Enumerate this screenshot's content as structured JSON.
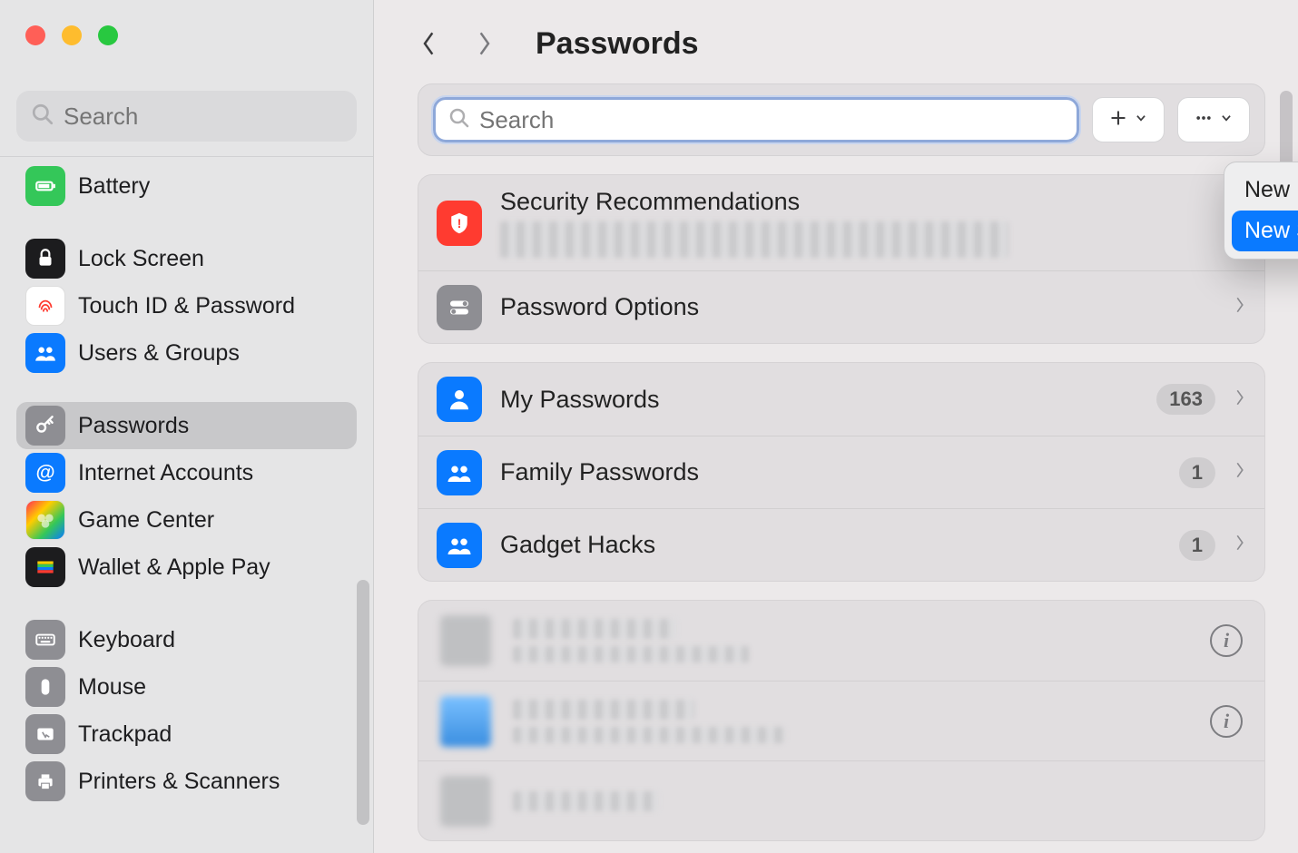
{
  "sidebar": {
    "search_placeholder": "Search",
    "items": [
      {
        "label": "Battery",
        "icon": "battery-icon",
        "bg": "bg-green"
      },
      {
        "label": "Lock Screen",
        "icon": "lock-icon",
        "bg": "bg-black"
      },
      {
        "label": "Touch ID & Password",
        "icon": "fingerprint-icon",
        "bg": "bg-white"
      },
      {
        "label": "Users & Groups",
        "icon": "users-icon",
        "bg": "bg-blue"
      },
      {
        "label": "Passwords",
        "icon": "key-icon",
        "bg": "bg-grey",
        "selected": true
      },
      {
        "label": "Internet Accounts",
        "icon": "at-icon",
        "bg": "bg-blue"
      },
      {
        "label": "Game Center",
        "icon": "gamecenter-icon",
        "bg": "bg-white"
      },
      {
        "label": "Wallet & Apple Pay",
        "icon": "wallet-icon",
        "bg": "bg-black"
      },
      {
        "label": "Keyboard",
        "icon": "keyboard-icon",
        "bg": "bg-grey"
      },
      {
        "label": "Mouse",
        "icon": "mouse-icon",
        "bg": "bg-grey"
      },
      {
        "label": "Trackpad",
        "icon": "trackpad-icon",
        "bg": "bg-grey"
      },
      {
        "label": "Printers & Scanners",
        "icon": "printer-icon",
        "bg": "bg-grey"
      }
    ]
  },
  "header": {
    "title": "Passwords"
  },
  "toolbar": {
    "search_placeholder": "Search",
    "plus_icon": "plus-icon",
    "more_icon": "ellipsis-icon"
  },
  "popover": {
    "items": [
      {
        "label": "New Password",
        "highlight": false
      },
      {
        "label": "New Shared Group",
        "highlight": true
      }
    ]
  },
  "section_settings": {
    "rows": [
      {
        "label": "Security Recommendations",
        "icon": "shield-alert-icon",
        "bg": "bg-red",
        "subtitle_redacted": true
      },
      {
        "label": "Password Options",
        "icon": "switch-icon",
        "bg": "bg-grey2"
      }
    ]
  },
  "section_groups": {
    "rows": [
      {
        "label": "My Passwords",
        "icon": "person-icon",
        "bg": "bg-blue2",
        "count": "163"
      },
      {
        "label": "Family Passwords",
        "icon": "people-icon",
        "bg": "bg-blue2",
        "count": "1"
      },
      {
        "label": "Gadget Hacks",
        "icon": "people-icon",
        "bg": "bg-blue2",
        "count": "1"
      }
    ]
  },
  "section_entries": {
    "rows": [
      {
        "redacted": true
      },
      {
        "redacted": true,
        "blue_avatar": true
      },
      {
        "redacted": true
      }
    ]
  },
  "colors": {
    "accent": "#0a7aff",
    "sidebar_bg": "#e5e5e6",
    "main_bg": "#ece9ea"
  }
}
